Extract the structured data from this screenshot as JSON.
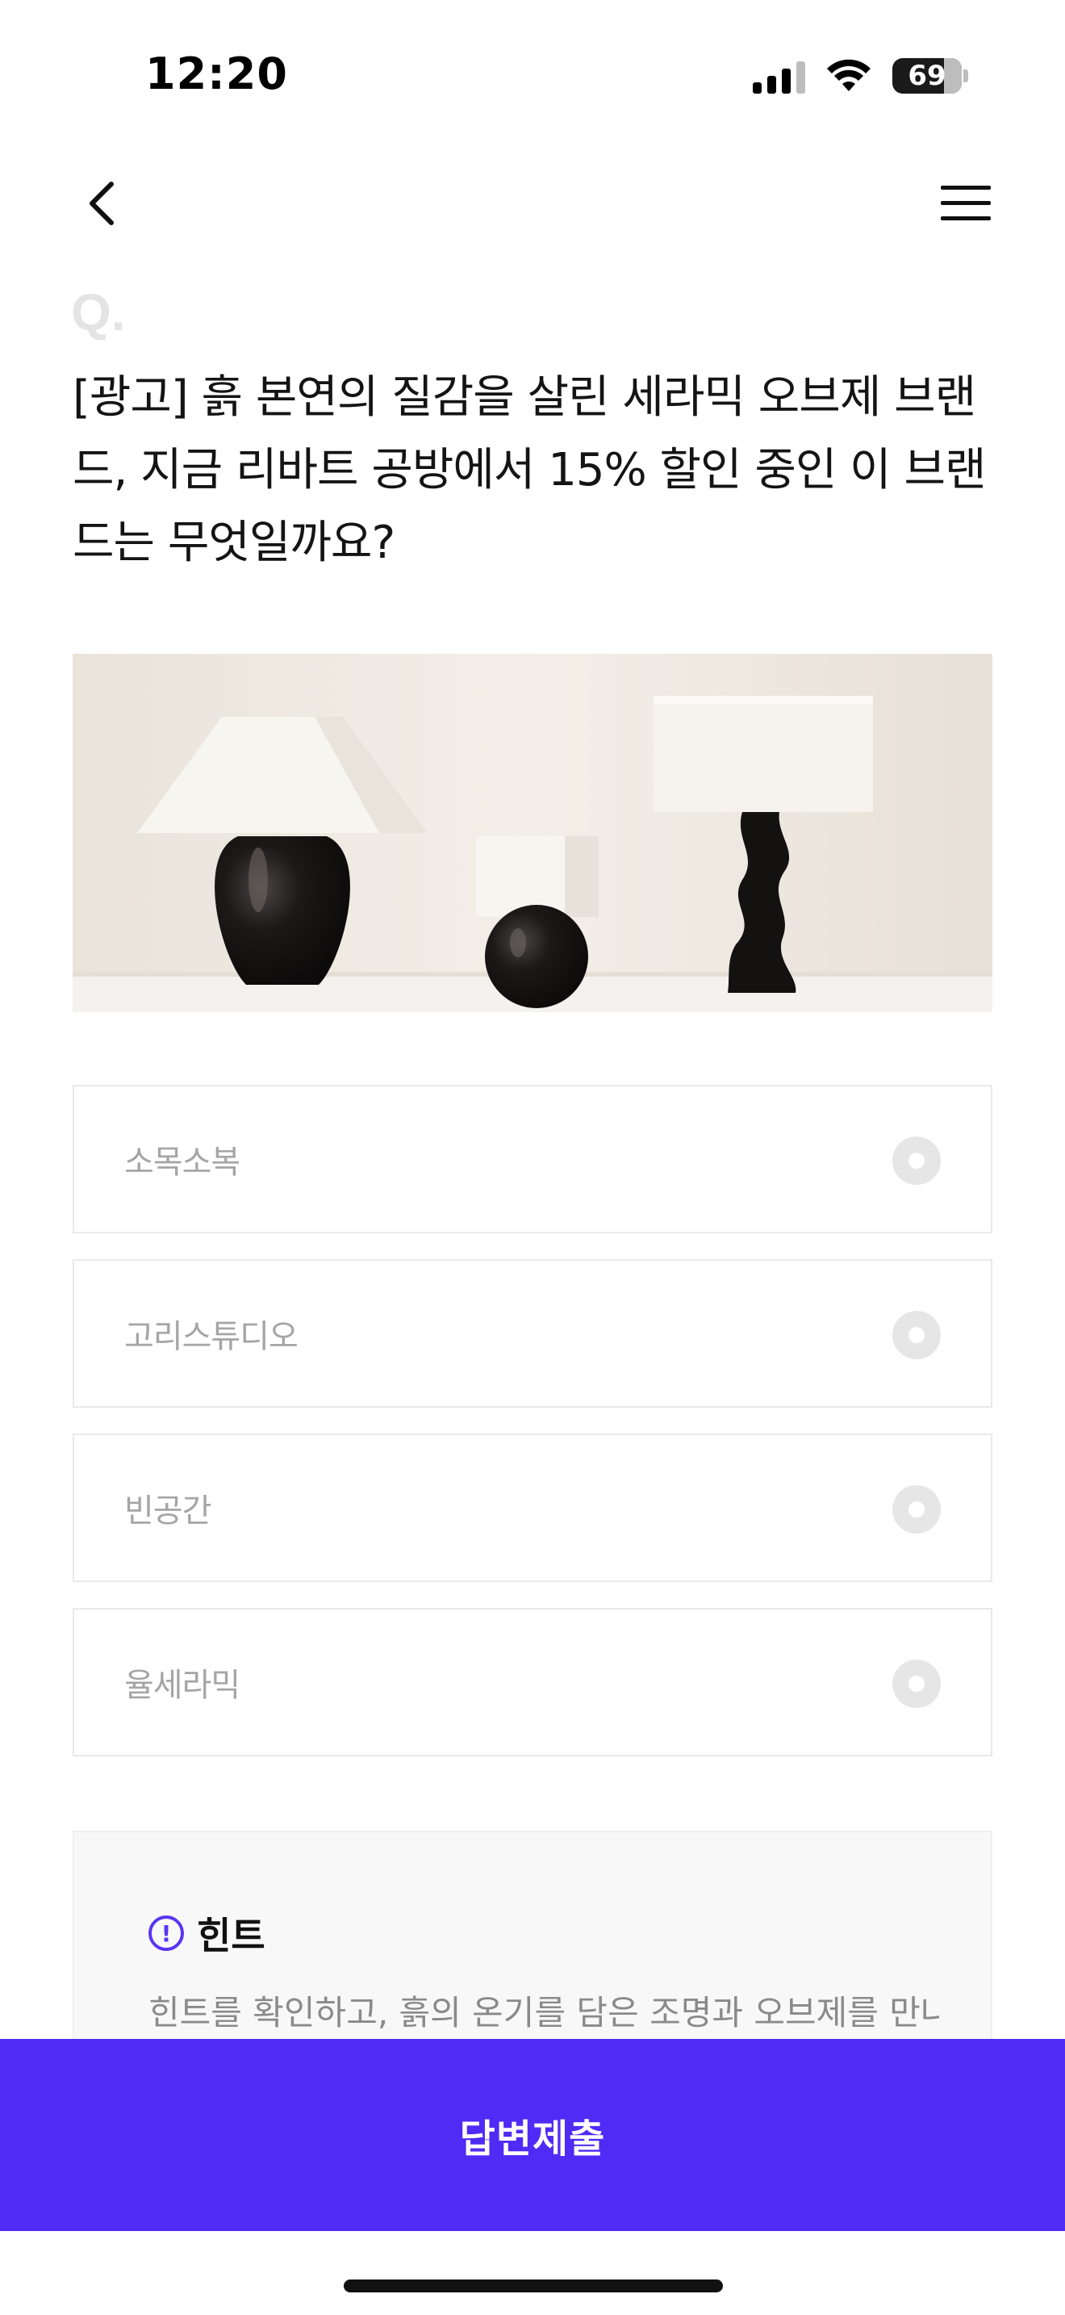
{
  "status_bar": {
    "time": "12:20",
    "battery": "69",
    "icons": [
      "signal-icon",
      "wifi-icon",
      "battery-icon"
    ]
  },
  "nav": {
    "back_icon": "chevron-left-icon",
    "menu_icon": "hamburger-menu-icon"
  },
  "question": {
    "marker": "Q.",
    "text": "[광고] 흙 본연의 질감을 살린 세라믹 오브제 브랜드, 지금 리바트 공방에서 15% 할인 중인 이 브랜드는 무엇일까요?"
  },
  "image": {
    "subject": "three ceramic table lamps on a white shelf"
  },
  "options": [
    {
      "label": "소목소복"
    },
    {
      "label": "고리스튜디오"
    },
    {
      "label": "빈공간"
    },
    {
      "label": "율세라믹"
    }
  ],
  "hint": {
    "title": "힌트",
    "text": "힌트를 확인하고, 흙의 온기를 담은 조명과 오브제를 만나"
  },
  "submit": {
    "label": "답변제출"
  },
  "colors": {
    "accent": "#4f2bf5",
    "option_text": "#a5a5a5",
    "option_border": "#e9e9e9"
  }
}
